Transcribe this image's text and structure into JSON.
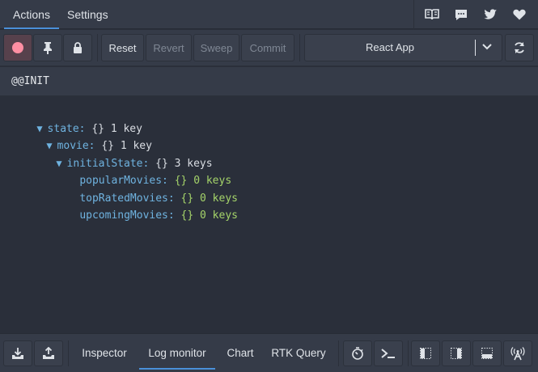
{
  "tabs": {
    "actions": "Actions",
    "settings": "Settings"
  },
  "topbar_icons": [
    "book-icon",
    "chat-icon",
    "twitter-icon",
    "heart-icon"
  ],
  "toolbar": {
    "reset": "Reset",
    "revert": "Revert",
    "sweep": "Sweep",
    "commit": "Commit",
    "instance": "React App"
  },
  "action_name": "@@INIT",
  "tree": {
    "state": {
      "key": "state:",
      "braces": "{}",
      "count": "1 key"
    },
    "movie": {
      "key": "movie:",
      "braces": "{}",
      "count": "1 key"
    },
    "initialState": {
      "key": "initialState:",
      "braces": "{}",
      "count": "3 keys"
    },
    "popularMovies": {
      "key": "popularMovies:",
      "braces": "{}",
      "count": "0 keys"
    },
    "topRatedMovies": {
      "key": "topRatedMovies:",
      "braces": "{}",
      "count": "0 keys"
    },
    "upcomingMovies": {
      "key": "upcomingMovies:",
      "braces": "{}",
      "count": "0 keys"
    }
  },
  "bottom_tabs": {
    "inspector": "Inspector",
    "log_monitor": "Log monitor",
    "chart": "Chart",
    "rtk_query": "RTK Query"
  },
  "colors": {
    "background": "#2a2f3a",
    "panel": "#353b48",
    "accent": "#4a90d9",
    "key": "#6fb3e0",
    "value": "#a5d46a",
    "record": "#ff8fa3"
  }
}
